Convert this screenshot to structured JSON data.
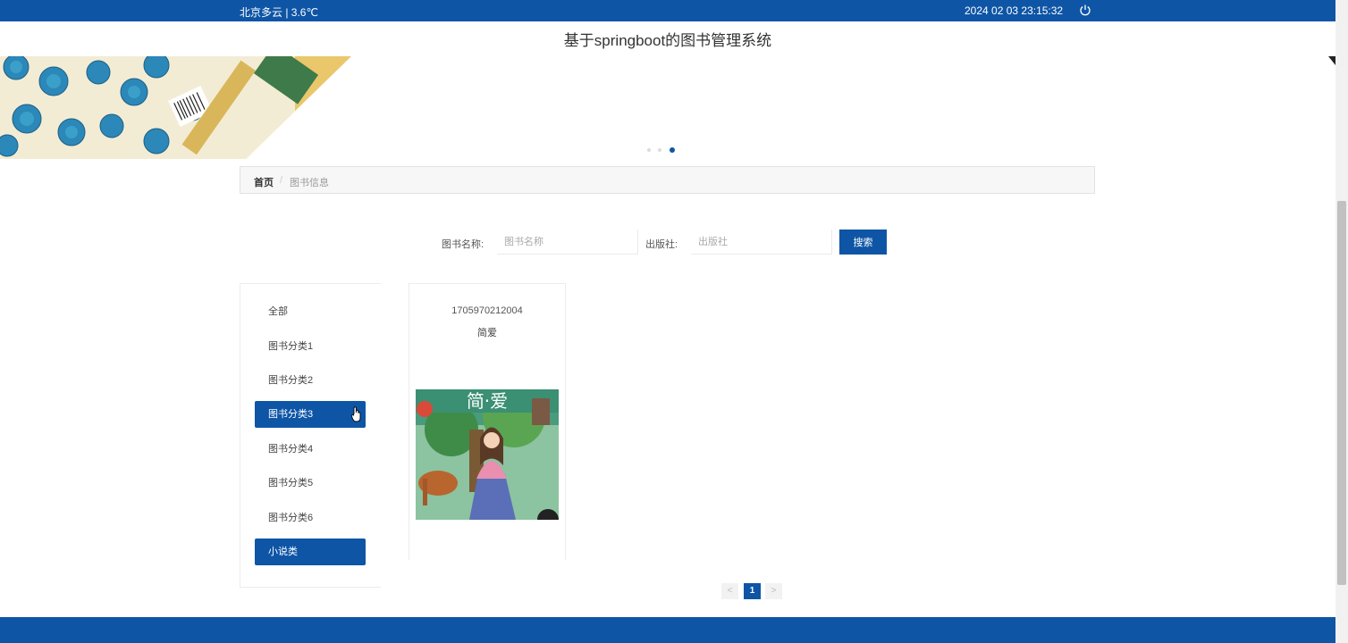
{
  "topbar": {
    "weather": "北京多云 |  3.6℃",
    "datetime": "2024 02 03   23:15:32",
    "power_icon": "power-icon"
  },
  "site_title": "基于springboot的图书管理系统",
  "carousel": {
    "count": 3,
    "active_index": 2
  },
  "breadcrumb": {
    "home": "首页",
    "separator": "/",
    "current": "图书信息"
  },
  "search": {
    "name_label": "图书名称:",
    "name_placeholder": "图书名称",
    "publisher_label": "出版社:",
    "publisher_placeholder": "出版社",
    "button": "搜索"
  },
  "categories": [
    {
      "label": "全部",
      "active": false
    },
    {
      "label": "图书分类1",
      "active": false
    },
    {
      "label": "图书分类2",
      "active": false
    },
    {
      "label": "图书分类3",
      "active": true
    },
    {
      "label": "图书分类4",
      "active": false
    },
    {
      "label": "图书分类5",
      "active": false
    },
    {
      "label": "图书分类6",
      "active": false
    },
    {
      "label": "小说类",
      "active": true
    }
  ],
  "book": {
    "id": "1705970212004",
    "name": "简爱",
    "cover_title": "简·爱"
  },
  "pagination": {
    "prev": "<",
    "current": "1",
    "next": ">"
  },
  "colors": {
    "primary": "#0e55a6"
  }
}
